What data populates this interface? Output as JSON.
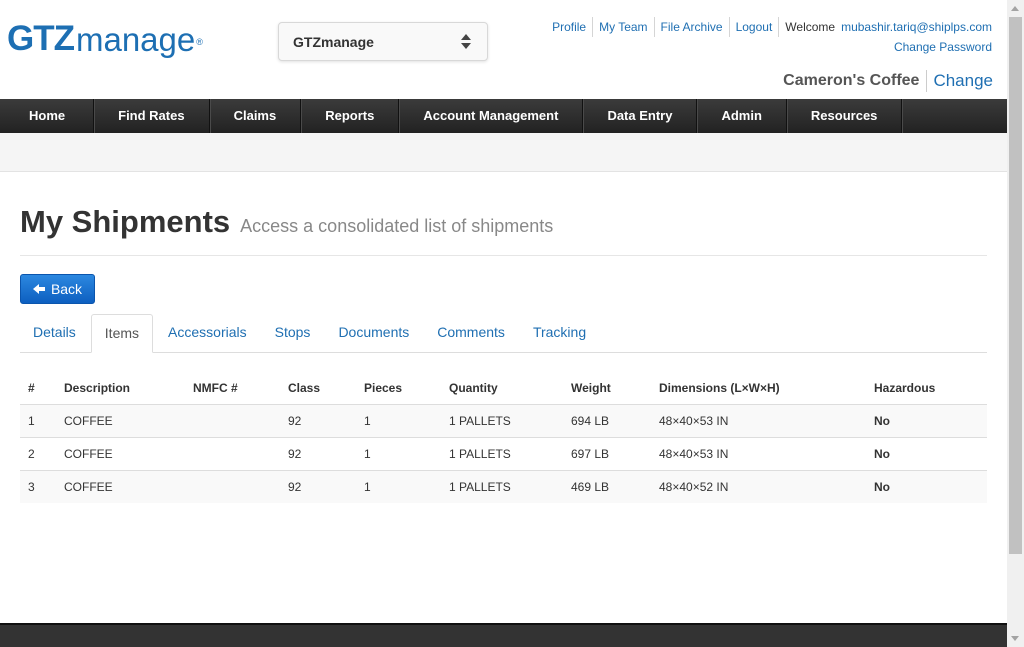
{
  "brand": {
    "logo_part1": "GTZ",
    "logo_part2": "manage",
    "logo_mark": "®",
    "color": "#1d6fb3"
  },
  "header": {
    "company_select": {
      "selected": "GTZmanage"
    },
    "links": [
      "Profile",
      "My Team",
      "File Archive",
      "Logout"
    ],
    "welcome_label": "Welcome",
    "user_email": "mubashir.tariq@shiplps.com",
    "change_password": "Change Password",
    "customer_name": "Cameron's Coffee",
    "customer_change": "Change"
  },
  "nav": {
    "items": [
      "Home",
      "Find Rates",
      "Claims",
      "Reports",
      "Account Management",
      "Data Entry",
      "Admin",
      "Resources"
    ]
  },
  "page": {
    "title": "My Shipments",
    "subtitle": "Access a consolidated list of shipments",
    "back_label": "Back"
  },
  "tabs": {
    "items": [
      "Details",
      "Items",
      "Accessorials",
      "Stops",
      "Documents",
      "Comments",
      "Tracking"
    ],
    "active": "Items"
  },
  "table": {
    "headers": [
      "#",
      "Description",
      "NMFC #",
      "Class",
      "Pieces",
      "Quantity",
      "Weight",
      "Dimensions (L×W×H)",
      "Hazardous"
    ],
    "rows": [
      [
        "1",
        "COFFEE",
        "",
        "92",
        "1",
        "1 PALLETS",
        "694 LB",
        "48×40×53 IN",
        "No"
      ],
      [
        "2",
        "COFFEE",
        "",
        "92",
        "1",
        "1 PALLETS",
        "697 LB",
        "48×40×53 IN",
        "No"
      ],
      [
        "3",
        "COFFEE",
        "",
        "92",
        "1",
        "1 PALLETS",
        "469 LB",
        "48×40×52 IN",
        "No"
      ]
    ]
  },
  "colors": {
    "link": "#1f6fb2",
    "nav_bg": "#2b2b2b",
    "button": "#0d5fc0"
  }
}
